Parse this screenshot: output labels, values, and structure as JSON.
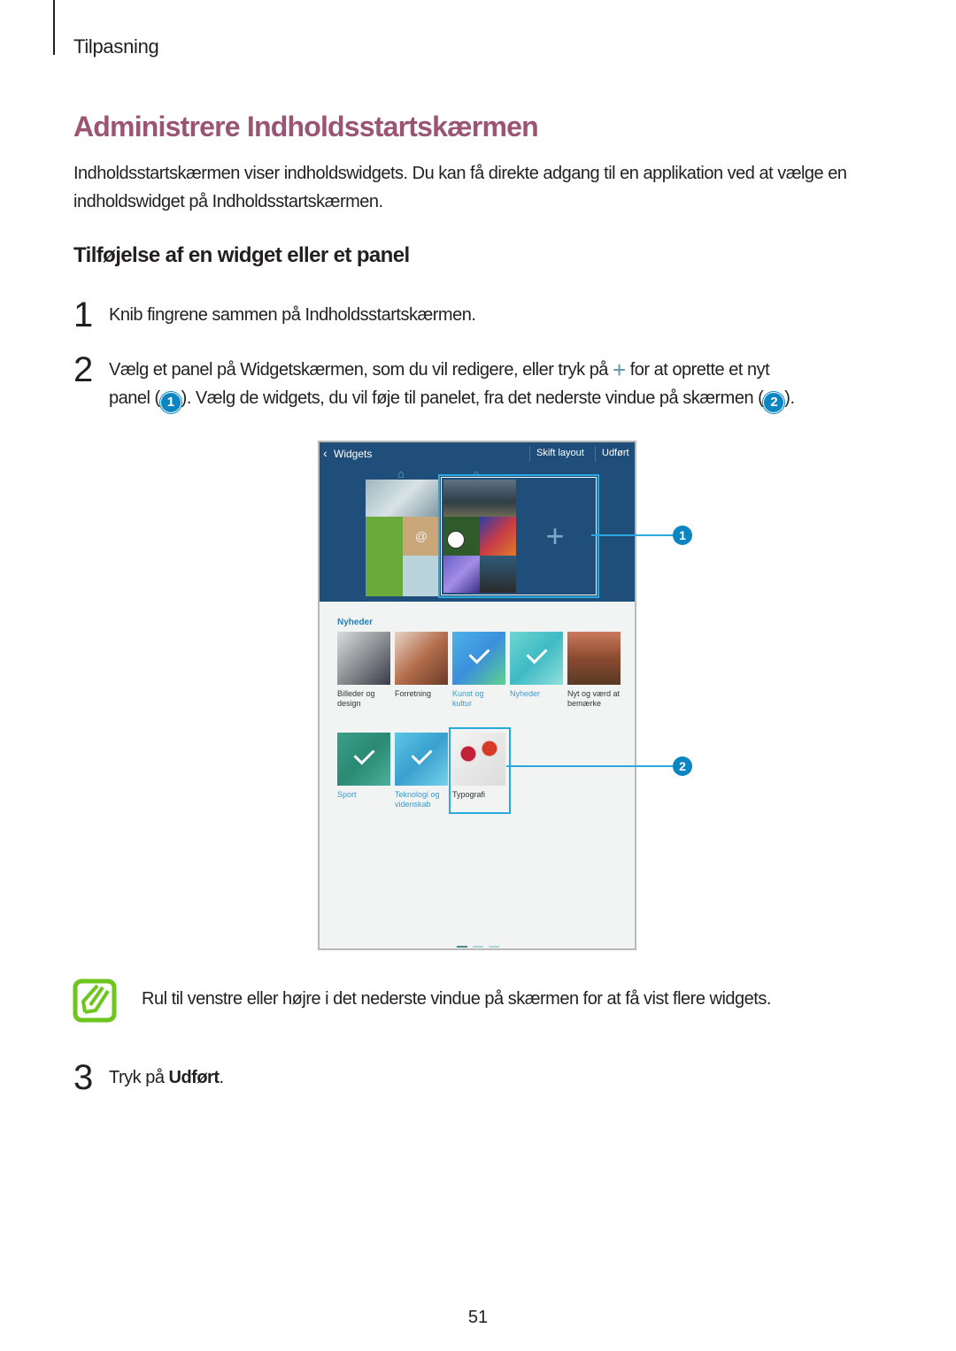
{
  "header": {
    "section": "Tilpasning"
  },
  "title": "Administrere Indholdsstartskærmen",
  "intro": "Indholdsstartskærmen viser indholdswidgets. Du kan få direkte adgang til en applikation ved at vælge en indholdswidget på Indholdsstartskærmen.",
  "subheading": "Tilføjelse af en widget eller et panel",
  "steps": [
    {
      "number": "1",
      "text": "Knib fingrene sammen på Indholdsstartskærmen."
    },
    {
      "number": "2",
      "text_a": "Vælg et panel på Widgetskærmen, som du vil redigere, eller tryk på",
      "icon": "plus-icon",
      "text_b": "for at oprette et nyt",
      "text_c": "panel (",
      "callout1": "1",
      "text_d": "). Vælg de widgets, du vil føje til panelet, fra det nederste vindue på skærmen (",
      "callout2": "2",
      "text_e": ")."
    },
    {
      "number": "3",
      "text_a": "Tryk på ",
      "bold": "Udført",
      "text_b": "."
    }
  ],
  "device": {
    "topbar": {
      "title": "Widgets",
      "skift": "Skift layout",
      "done": "Udført"
    },
    "plus": "+",
    "at_sign": "@",
    "category": "Nyheder",
    "tiles": [
      {
        "label": "Billeder og design",
        "selected": false
      },
      {
        "label": "Forretning",
        "selected": false
      },
      {
        "label": "Kunst og kultur",
        "selected": true
      },
      {
        "label": "Nyheder",
        "selected": true
      },
      {
        "label": "Nyt og værd at bemærke",
        "selected": false
      },
      {
        "label": "Sport",
        "selected": true
      },
      {
        "label": "Teknologi og videnskab",
        "selected": true
      },
      {
        "label": "Typografi",
        "selected": false
      }
    ],
    "callouts": [
      "1",
      "2"
    ],
    "page_indicator": {
      "pages": 3,
      "current": 1
    }
  },
  "note": "Rul til venstre eller højre i det nederste vindue på skærmen for at få vist flere widgets.",
  "page_number": "51",
  "colors": {
    "title": "#9b5573",
    "callout": "#0b86c2",
    "note_icon": "#6dc51e",
    "device_bar": "#1f4e7a"
  }
}
